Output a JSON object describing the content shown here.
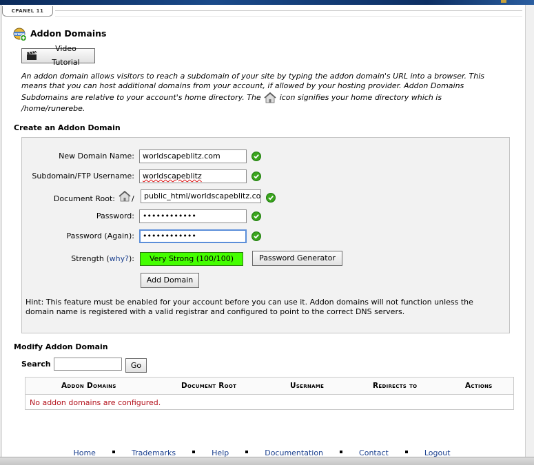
{
  "header": {
    "cpanel_tab": "CPANEL 11"
  },
  "page": {
    "title": "Addon Domains",
    "video_button": "Video Tutorial",
    "description_part1": "An addon domain allows visitors to reach a subdomain of your site by typing the addon domain's URL into a browser. This means that you can host additional domains from your account, if allowed by your hosting provider. Addon Domains Subdomains are relative to your account's home directory. The",
    "description_part2": "icon signifies your home directory which is",
    "description_path": "/home/runerebe."
  },
  "create": {
    "section_title": "Create an Addon Domain",
    "new_domain_label": "New Domain Name:",
    "new_domain_value": "worldscapeblitz.com",
    "subdomain_label": "Subdomain/FTP Username:",
    "subdomain_value": "worldscapeblitz",
    "docroot_label": "Document Root:",
    "docroot_slash": "/",
    "docroot_value": "public_html/worldscapeblitz.co",
    "password_label": "Password:",
    "password_value": "••••••••••••",
    "password_again_label": "Password (Again):",
    "password_again_value": "••••••••••••",
    "strength_label": "Strength (",
    "strength_why": "why?",
    "strength_label_end": "):",
    "strength_value": "Very Strong (100/100)",
    "strength_color": "#44ff00",
    "password_generator_button": "Password Generator",
    "add_domain_button": "Add Domain",
    "hint": "Hint: This feature must be enabled for your account before you can use it. Addon domains will not function unless the domain name is registered with a valid registrar and configured to point to the correct DNS servers."
  },
  "modify": {
    "section_title": "Modify Addon Domain",
    "search_label": "Search",
    "search_value": "",
    "go_button": "Go",
    "columns": [
      "Addon Domains",
      "Document Root",
      "Username",
      "Redirects to",
      "Actions"
    ],
    "empty_message": "No addon domains are configured."
  },
  "footer": {
    "links": [
      "Home",
      "Trademarks",
      "Help",
      "Documentation",
      "Contact",
      "Logout"
    ]
  },
  "colors": {
    "link": "#1a3f8e",
    "error_text": "#b3121c",
    "check_green": "#3aa41d"
  }
}
